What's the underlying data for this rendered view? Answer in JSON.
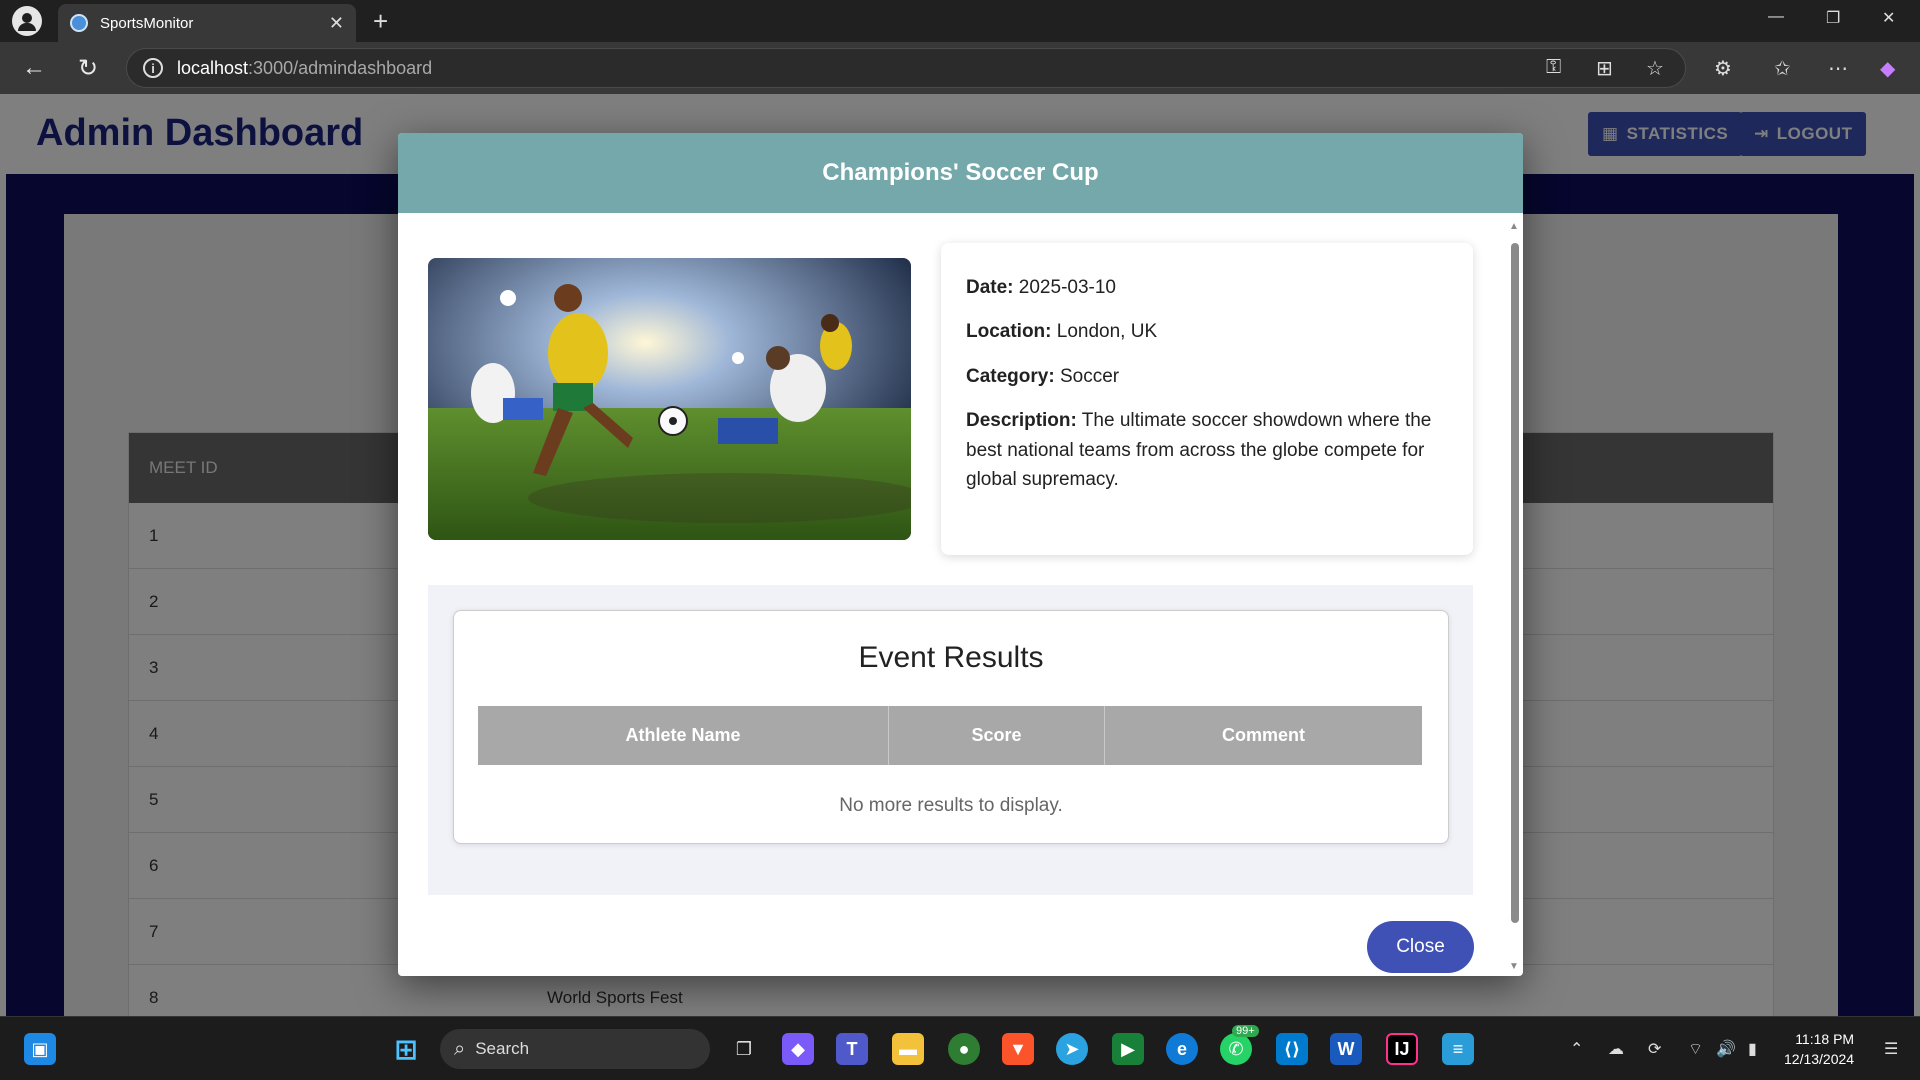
{
  "browser": {
    "tab_title": "SportsMonitor",
    "url_host": "localhost",
    "url_rest": ":3000/admindashboard"
  },
  "page": {
    "title": "Admin Dashboard",
    "statistics_label": "STATISTICS",
    "logout_label": "LOGOUT",
    "table_header": "MEET ID",
    "rows": [
      "1",
      "2",
      "3",
      "4",
      "5",
      "6",
      "7",
      "8"
    ],
    "last_row_name": "World Sports Fest"
  },
  "modal": {
    "title": "Champions' Soccer Cup",
    "date_label": "Date:",
    "date_value": "2025-03-10",
    "location_label": "Location:",
    "location_value": "London, UK",
    "category_label": "Category:",
    "category_value": "Soccer",
    "description_label": "Description:",
    "description_value": "The ultimate soccer showdown where the best national teams from across the globe compete for global supremacy.",
    "results_title": "Event Results",
    "columns": [
      "Athlete Name",
      "Score",
      "Comment"
    ],
    "empty_text": "No more results to display.",
    "close_label": "Close"
  },
  "taskbar": {
    "search_label": "Search",
    "badge": "99+",
    "time": "11:18 PM",
    "date": "12/13/2024"
  },
  "colors": {
    "modal_header": "#74a8ab",
    "primary": "#3f51b5",
    "title": "#1a237e"
  }
}
